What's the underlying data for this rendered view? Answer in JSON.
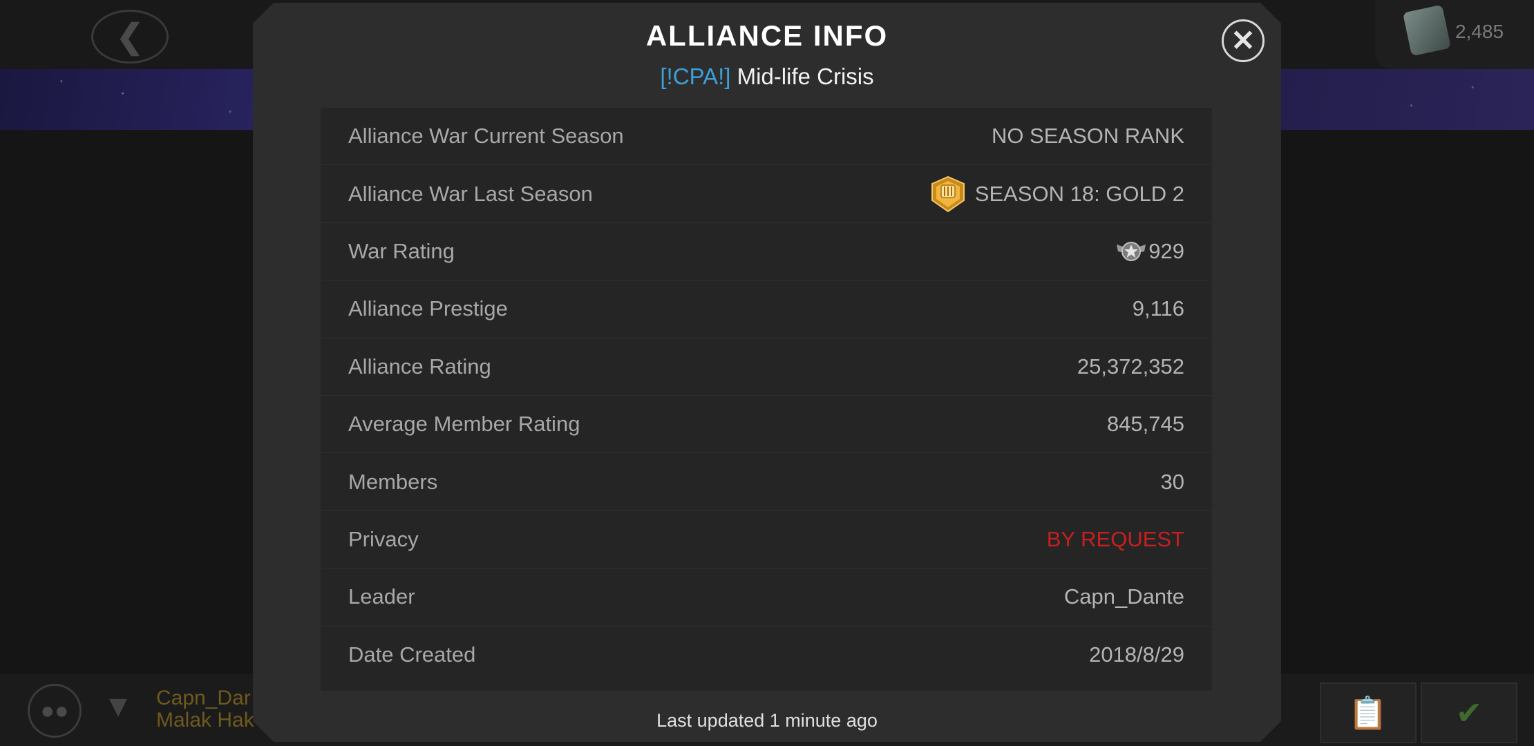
{
  "background": {
    "currency_value": "2,485",
    "bottom_names": [
      "Capn_Dar",
      "Malak Hak"
    ]
  },
  "modal": {
    "title": "ALLIANCE INFO",
    "alliance_tag": "[!CPA!]",
    "alliance_name": " Mid-life Crisis",
    "footer": "Last updated 1 minute ago"
  },
  "rows": [
    {
      "label": "Alliance War Current Season",
      "value": "NO SEASON RANK"
    },
    {
      "label": "Alliance War Last Season",
      "value": "SEASON 18: GOLD 2",
      "icon": "gold-shield-icon"
    },
    {
      "label": "War Rating",
      "value": "929",
      "icon": "war-rating-emblem-icon"
    },
    {
      "label": "Alliance Prestige",
      "value": "9,116"
    },
    {
      "label": "Alliance Rating",
      "value": "25,372,352"
    },
    {
      "label": "Average Member Rating",
      "value": "845,745"
    },
    {
      "label": "Members",
      "value": "30"
    },
    {
      "label": "Privacy",
      "value": "BY REQUEST",
      "color": "#c8201e"
    },
    {
      "label": "Leader",
      "value": "Capn_Dante"
    },
    {
      "label": "Date Created",
      "value": "2018/8/29"
    }
  ],
  "colors": {
    "tag_blue": "#3e9ed8",
    "privacy_red": "#c8201e",
    "modal_bg": "#2d2d2d",
    "table_bg": "#252525"
  }
}
